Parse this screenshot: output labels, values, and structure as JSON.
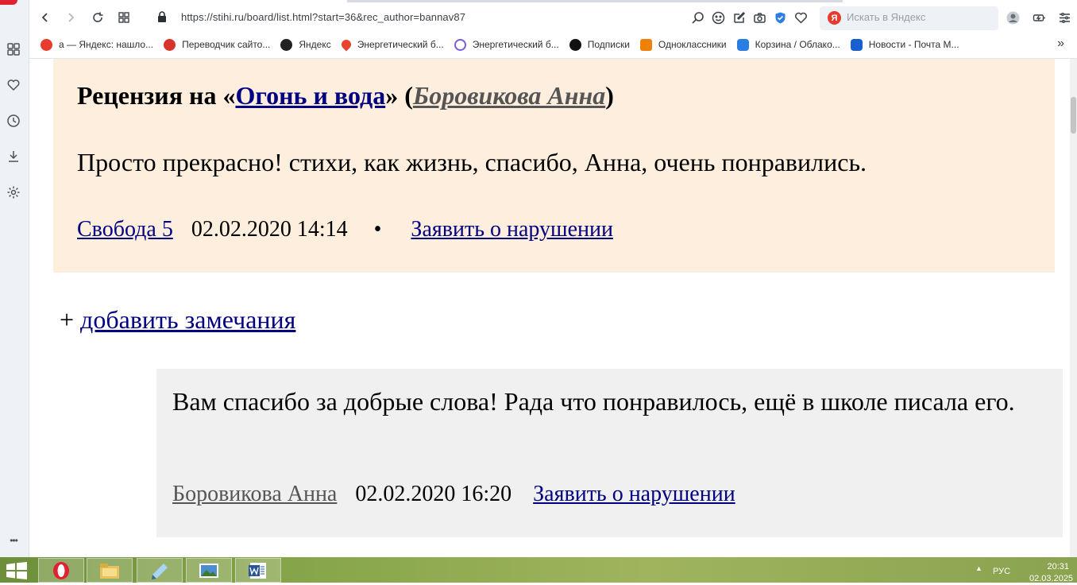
{
  "browser": {
    "url": "https://stihi.ru/board/list.html?start=36&rec_author=bannav87",
    "search_placeholder": "Искать в Яндекс",
    "search_logo": "Я",
    "sidebar_more": "•••",
    "bookmarks_more": "»"
  },
  "bookmarks": [
    {
      "label": "а — Яндекс: нашло...",
      "color": "#e63b2e"
    },
    {
      "label": "Переводчик сайто...",
      "color": "#d9342b"
    },
    {
      "label": "Яндекс",
      "color": "#222222"
    },
    {
      "label": "Энергетический б...",
      "color": "#e8432e"
    },
    {
      "label": "Энергетический б...",
      "color": "#7a5cd6"
    },
    {
      "label": "Подписки",
      "color": "#111111"
    },
    {
      "label": "Одноклассники",
      "color": "#ee8208"
    },
    {
      "label": "Корзина / Облако...",
      "color": "#2a7de1"
    },
    {
      "label": "Новости - Почта М...",
      "color": "#1a5fd0"
    }
  ],
  "review": {
    "title_prefix": "Рецензия на «",
    "poem_title": "Огонь и вода",
    "title_mid": "» (",
    "author": "Боровикова Анна",
    "title_suffix": ")",
    "text": "Просто прекрасно! стихи, как жизнь, спасибо, Анна, очень понравились.",
    "reviewer": "Свобода 5",
    "date": "02.02.2020 14:14",
    "separator": "•",
    "report_link": "Заявить о нарушении"
  },
  "add_remarks": {
    "plus": "+",
    "label": "добавить замечания"
  },
  "reply": {
    "text": "Вам спасибо за добрые слова! Рада что понравилось, ещё в школе писала его.",
    "author": "Боровикова Анна",
    "date": "02.02.2020 16:20",
    "report_link": "Заявить о нарушении"
  },
  "taskbar": {
    "lang": "РУС",
    "time": "20:31",
    "date": "02.03.2025",
    "items": [
      "opera",
      "file-explorer",
      "notepad",
      "image-viewer",
      "word"
    ]
  }
}
